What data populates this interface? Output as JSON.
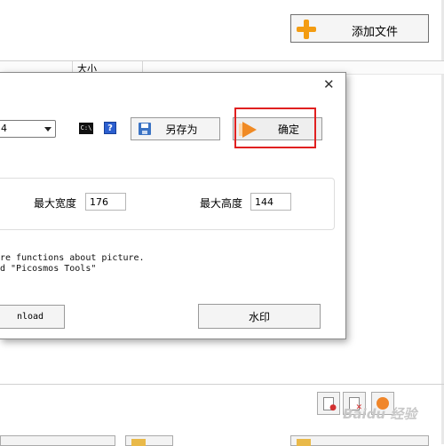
{
  "main": {
    "add_file_label": "添加文件",
    "column_size": "大小",
    "watermark_text": "Baidu 经验"
  },
  "dialog": {
    "dropdown_value": "4",
    "cmd_icon_glyph": "C:\\",
    "help_glyph": "?",
    "save_as_label": "另存为",
    "ok_label": "确定",
    "max_width_label": "最大宽度",
    "max_width_value": "176",
    "max_height_label": "最大高度",
    "max_height_value": "144",
    "description_line1": "re functions about picture.",
    "description_line2": "d \"Picosmos Tools\"",
    "download_label": "nload",
    "watermark_button_label": "水印"
  },
  "icons": {
    "add": "plus-icon",
    "close": "close-icon",
    "save": "floppy-icon",
    "ok": "arrow-right-icon",
    "cmd": "console-icon",
    "help": "help-icon"
  },
  "colors": {
    "accent_orange": "#f39c12",
    "highlight_red": "#e02020",
    "help_blue": "#2c5fcf"
  }
}
